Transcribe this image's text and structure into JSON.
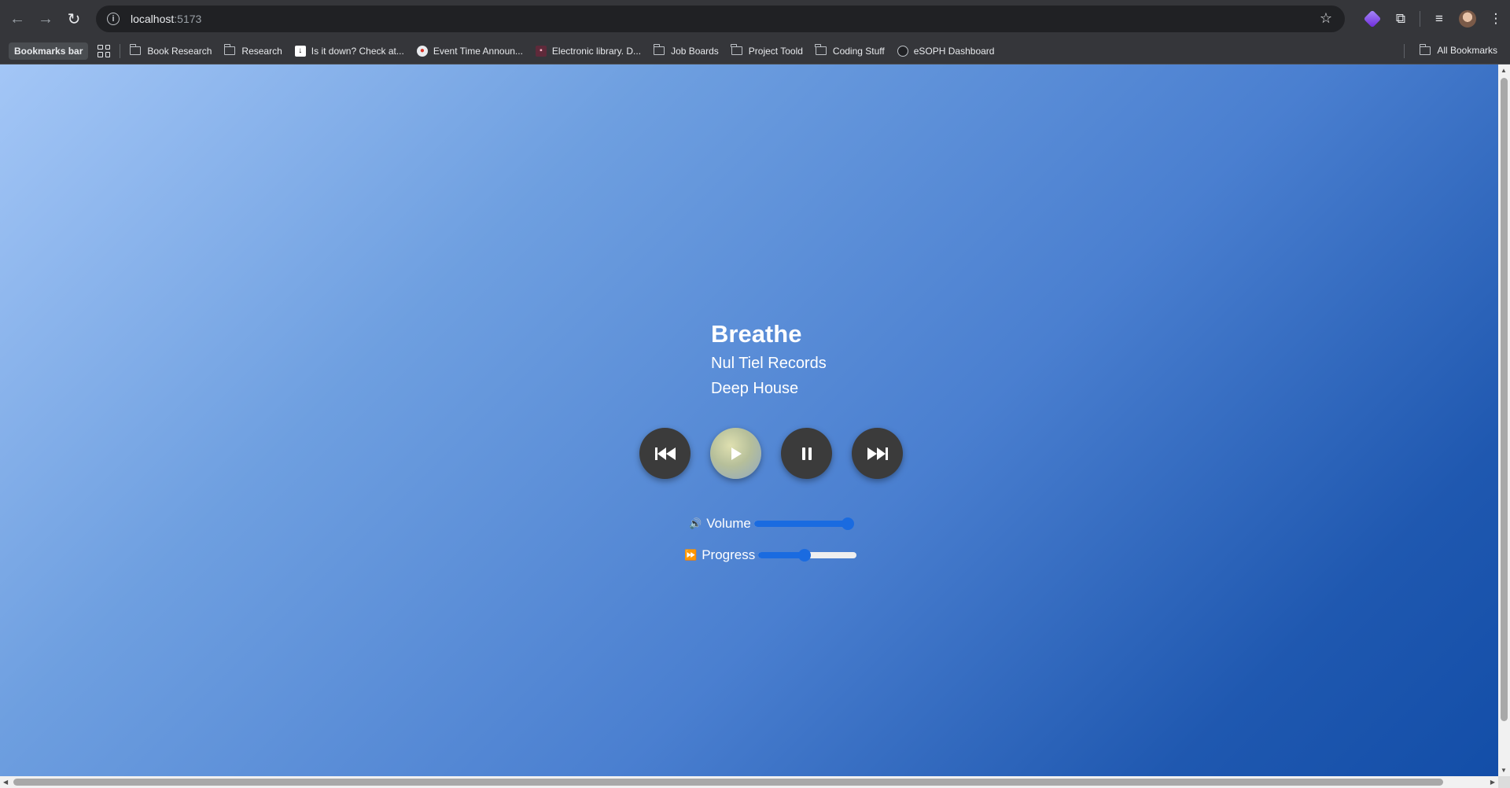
{
  "browser": {
    "url_host": "localhost",
    "url_port": ":5173",
    "bookmarks_bar_label": "Bookmarks bar",
    "bookmarks": [
      {
        "label": "Book Research",
        "icon": "folder-icon"
      },
      {
        "label": "Research",
        "icon": "folder-icon"
      },
      {
        "label": "Is it down? Check at...",
        "icon": "down-arrow-favicon"
      },
      {
        "label": "Event Time Announ...",
        "icon": "event-favicon"
      },
      {
        "label": "Electronic library. D...",
        "icon": "library-favicon"
      },
      {
        "label": "Job Boards",
        "icon": "folder-icon"
      },
      {
        "label": "Project Toold",
        "icon": "folder-icon"
      },
      {
        "label": "Coding Stuff",
        "icon": "folder-icon"
      },
      {
        "label": "eSOPH Dashboard",
        "icon": "esoph-favicon"
      }
    ],
    "all_bookmarks_label": "All Bookmarks"
  },
  "player": {
    "title": "Breathe",
    "artist": "Nul Tiel Records",
    "genre": "Deep House",
    "controls": {
      "previous_icon": "skip-back-icon",
      "play_icon": "play-icon",
      "pause_icon": "pause-icon",
      "next_icon": "skip-forward-icon"
    },
    "volume": {
      "icon": "🔊",
      "label": "Volume",
      "level": 0.95
    },
    "progress": {
      "icon": "⏩",
      "label": "Progress",
      "level": 0.47
    }
  },
  "colors": {
    "accent": "#1a6be0",
    "button": "#3b3b3b",
    "gradient_start": "#a3c6f6",
    "gradient_end": "#134ea8"
  }
}
